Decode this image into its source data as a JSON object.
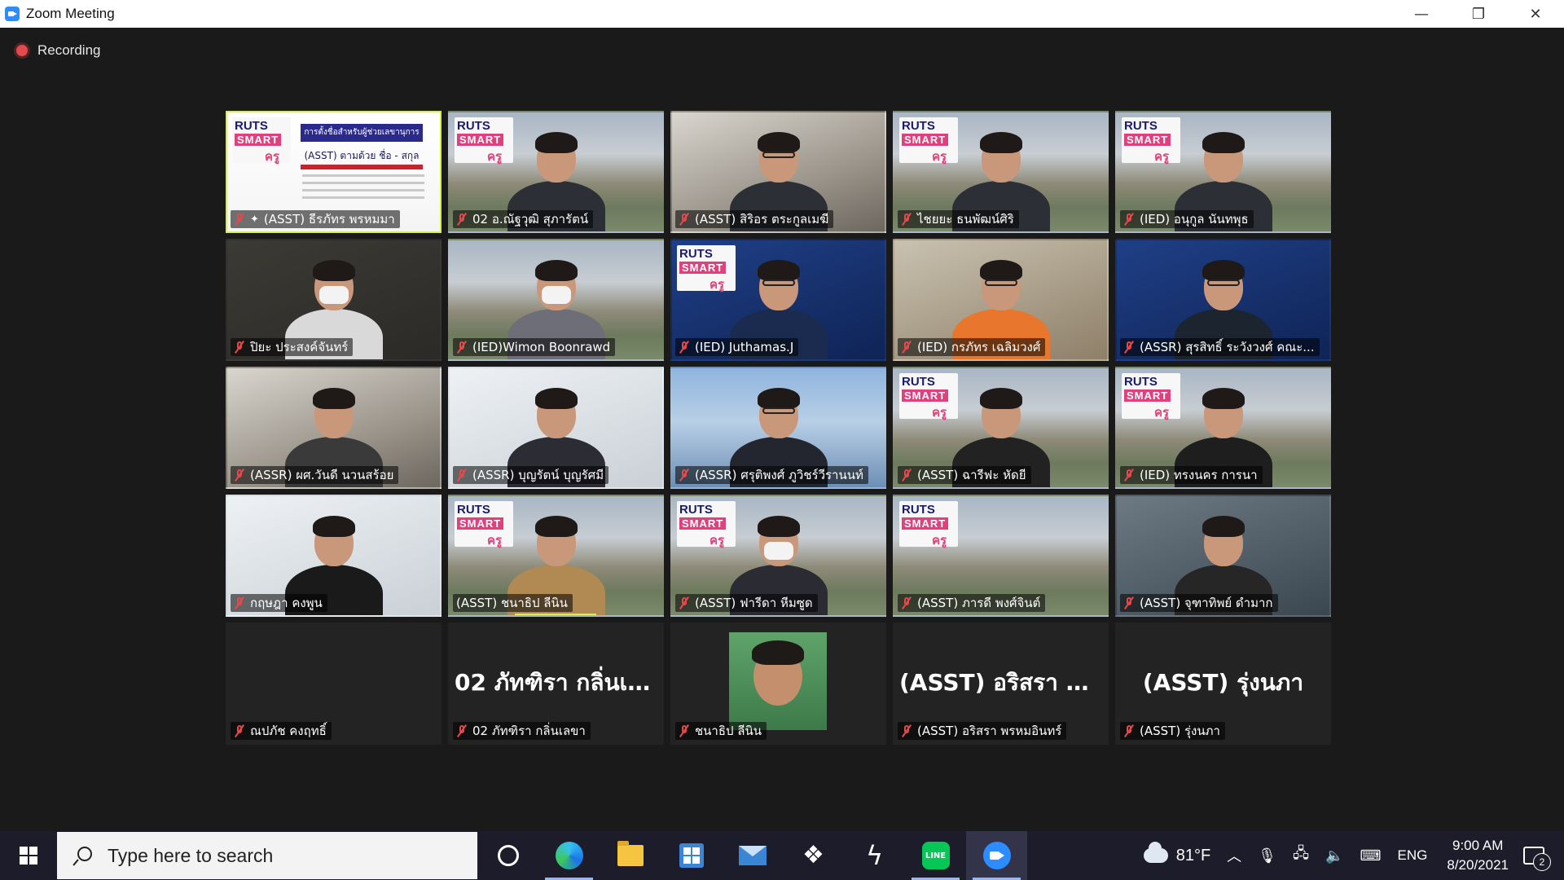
{
  "window": {
    "title": "Zoom Meeting",
    "minimize": "—",
    "restore": "❐",
    "close": "✕"
  },
  "recording": {
    "label": "Recording"
  },
  "tiles": [
    {
      "name": "(ASST) ธีรภัทร พรหมมา"
    },
    {
      "name": "02 อ.ณัฐวุฒิ สุภารัตน์"
    },
    {
      "name": "(ASST) สิริอร ตระกูลเมฆี"
    },
    {
      "name": "ไชยยะ ธนพัฒน์ศิริ"
    },
    {
      "name": "(IED) อนุกูล นันทพุธ"
    },
    {
      "name": "ปิยะ ประสงค์จันทร์"
    },
    {
      "name": "(IED)Wimon Boonrawd"
    },
    {
      "name": "(IED) Juthamas.J"
    },
    {
      "name": "(IED) กรภัทร เฉลิมวงศ์"
    },
    {
      "name": "(ASSR) สุรสิทธิ์ ระวังวงศ์ คณะ..."
    },
    {
      "name": "(ASSR) ผศ.วันดี นวนสร้อย"
    },
    {
      "name": "(ASSR) บุญรัตน์ บุญรัศมี"
    },
    {
      "name": "(ASSR) ศรุติพงศ์ ภูวิชร์วีรานนท์"
    },
    {
      "name": "(ASST) ฉารีฟะ หัดยี"
    },
    {
      "name": "(IED) ทรงนคร การนา"
    },
    {
      "name": "กฤษฎา คงพูน"
    },
    {
      "name": "(ASST) ชนาธิป ลีนิน"
    },
    {
      "name": "(ASST) ฟารีดา หีมซูด"
    },
    {
      "name": "(ASST) ภารดี พงศ์จินต์"
    },
    {
      "name": "(ASST) จุฑาทิพย์ ดำมาก"
    },
    {
      "name": "ณปภัช คงฤทธิ์"
    },
    {
      "name": "02 ภัทฑิรา กลิ่นเลขา",
      "display": "02 ภัทฑิรา กลิ่นเล..."
    },
    {
      "name": "ชนาธิป ลีนิน"
    },
    {
      "name": "(ASST) อริสรา พรหมอินทร์",
      "display": "(ASST) อริสรา พ..."
    },
    {
      "name": "(ASST) รุ่งนภา",
      "display": "(ASST) รุ่งนภา"
    }
  ],
  "slide": {
    "logo_top": "RUTS",
    "logo_mid": "SMART",
    "logo_bottom": "ครู",
    "banner": "การตั้งชื่อสำหรับผู้ช่วยเลขานุการ",
    "subtitle": "(ASST) ตามด้วย ชื่อ - สกุล"
  },
  "taskbar": {
    "search_placeholder": "Type here to search",
    "weather": "81°F",
    "language": "ENG",
    "time": "9:00 AM",
    "date": "8/20/2021",
    "notifications": "2",
    "line_label": "LINE"
  },
  "colors": {
    "active_border": "#d6ef4c",
    "mute_red": "#e5484d",
    "zoom_blue": "#2d8cff"
  }
}
